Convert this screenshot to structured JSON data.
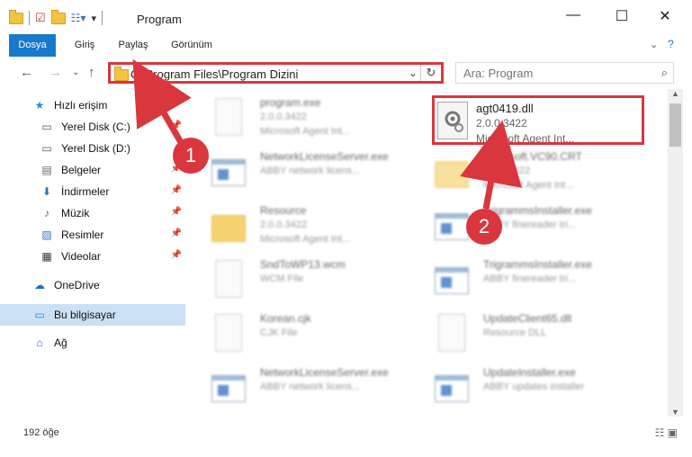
{
  "window": {
    "title": "Program"
  },
  "ribbon": {
    "tabs": [
      "Dosya",
      "Giriş",
      "Paylaş",
      "Görünüm"
    ]
  },
  "address": {
    "path": "C:\\Program Files\\Program Dizini"
  },
  "search": {
    "placeholder": "Ara: Program"
  },
  "sidebar": {
    "items": [
      {
        "label": "Hızlı erişim",
        "icon": "star-icon"
      },
      {
        "label": "Yerel Disk (C:)",
        "icon": "drive-icon"
      },
      {
        "label": "Yerel Disk (D:)",
        "icon": "drive-icon"
      },
      {
        "label": "Belgeler",
        "icon": "documents-icon"
      },
      {
        "label": "İndirmeler",
        "icon": "download-icon"
      },
      {
        "label": "Müzik",
        "icon": "music-icon"
      },
      {
        "label": "Resimler",
        "icon": "pictures-icon"
      },
      {
        "label": "Videolar",
        "icon": "video-icon"
      },
      {
        "label": "OneDrive",
        "icon": "cloud-icon"
      },
      {
        "label": "Bu bilgisayar",
        "icon": "computer-icon"
      },
      {
        "label": "Ağ",
        "icon": "network-icon"
      }
    ]
  },
  "files": {
    "left": [
      {
        "name": "program.exe",
        "l2": "2.0.0.3422",
        "l3": "Microsoft Agent Int..."
      },
      {
        "name": "NetworkLicenseServer.exe",
        "l2": "ABBY network licens...",
        "l3": ""
      },
      {
        "name": "Resource",
        "l2": "2.0.0.3422",
        "l3": "Microsoft Agent Int..."
      },
      {
        "name": "SndToWP13.wcm",
        "l2": "WCM File",
        "l3": ""
      },
      {
        "name": "Korean.cjk",
        "l2": "CJK File",
        "l3": ""
      },
      {
        "name": "NetworkLicenseServer.exe",
        "l2": "ABBY network licens...",
        "l3": ""
      }
    ],
    "right": [
      {
        "name": "agt0419.dll",
        "l2": "2.0.0.3422",
        "l3": "Microsoft Agent Int..."
      },
      {
        "name": "Microsoft.VC90.CRT",
        "l2": "2.0.0.3422",
        "l3": "Microsoft Agent Int..."
      },
      {
        "name": "TrigrammsInstaller.exe",
        "l2": "ABBY finereader tri...",
        "l3": ""
      },
      {
        "name": "TrigrammsInstaller.exe",
        "l2": "ABBY finereader tri...",
        "l3": ""
      },
      {
        "name": "UpdateClient65.dll",
        "l2": "Resource DLL",
        "l3": ""
      },
      {
        "name": "UpdateInstaller.exe",
        "l2": "ABBY updates installer",
        "l3": ""
      }
    ]
  },
  "annotations": {
    "one": "1",
    "two": "2"
  },
  "status": {
    "count": "192 öğe"
  },
  "colors": {
    "accent": "#1979ca",
    "highlight": "#d9363e"
  }
}
